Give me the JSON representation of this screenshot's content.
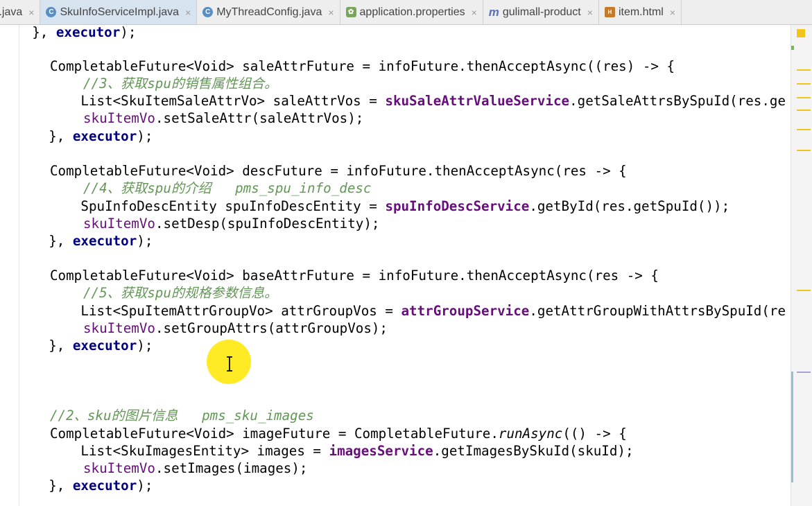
{
  "tabs": [
    {
      "label": "r.java",
      "icon": "java-file-icon",
      "active": false
    },
    {
      "label": "SkuInfoServiceImpl.java",
      "icon": "java-class-icon",
      "active": true
    },
    {
      "label": "MyThreadConfig.java",
      "icon": "java-class-icon",
      "active": false
    },
    {
      "label": "application.properties",
      "icon": "properties-file-icon",
      "active": false
    },
    {
      "label": "gulimall-product",
      "icon": "maven-module-icon",
      "active": false
    },
    {
      "label": "item.html",
      "icon": "html-file-icon",
      "active": false
    }
  ],
  "tab_icon_glyphs": {
    "java": "C",
    "props": "✿",
    "maven": "m",
    "html": "H"
  },
  "close_glyph": "×",
  "code": {
    "l1": {
      "a": "    }, ",
      "b": "executor",
      "c": ");"
    },
    "l2": "CompletableFuture<Void> saleAttrFuture = infoFuture.thenAcceptAsync((res) -> {",
    "l3": "//3、获取spu的销售属性组合。",
    "l4": {
      "a": "        List<SkuItemSaleAttrVo> saleAttrVos = ",
      "b": "skuSaleAttrValueService",
      "c": ".getSaleAttrsBySpuId(res.ge"
    },
    "l5": {
      "a": "skuItemVo",
      "b": ".setSaleAttr(saleAttrVos);"
    },
    "l6": {
      "a": "    }, ",
      "b": "executor",
      "c": ");"
    },
    "l7": "CompletableFuture<Void> descFuture = infoFuture.thenAcceptAsync(res -> {",
    "l8": "//4、获取spu的介绍   pms_spu_info_desc",
    "l9": {
      "a": "        SpuInfoDescEntity spuInfoDescEntity = ",
      "b": "spuInfoDescService",
      "c": ".getById(res.getSpuId());"
    },
    "l10": {
      "a": "skuItemVo",
      "b": ".setDesp(spuInfoDescEntity);"
    },
    "l11": {
      "a": "    }, ",
      "b": "executor",
      "c": ");"
    },
    "l12": "CompletableFuture<Void> baseAttrFuture = infoFuture.thenAcceptAsync(res -> {",
    "l13": "//5、获取spu的规格参数信息。",
    "l14": {
      "a": "        List<SpuItemAttrGroupVo> attrGroupVos = ",
      "b": "attrGroupService",
      "c": ".getAttrGroupWithAttrsBySpuId(re"
    },
    "l15": {
      "a": "skuItemVo",
      "b": ".setGroupAttrs(attrGroupVos);"
    },
    "l16": {
      "a": "    }, ",
      "b": "executor",
      "c": ");"
    },
    "l17": "//2、sku的图片信息   pms_sku_images",
    "l18": {
      "a": "CompletableFuture<Void> imageFuture = CompletableFuture.",
      "b": "runAsync",
      "c": "(() -> {"
    },
    "l19": {
      "a": "        List<SkuImagesEntity> images = ",
      "b": "imagesService",
      "c": ".getImagesBySkuId(skuId);"
    },
    "l20": {
      "a": "skuItemVo",
      "b": ".setImages(images);"
    },
    "l21": {
      "a": "    }, ",
      "b": "executor",
      "c": ");"
    }
  },
  "colors": {
    "keyword": "#000080",
    "field": "#660e7a",
    "comment": "#629755",
    "tab_active": "#d8e3f0",
    "cursor_highlight": "#ffe600"
  }
}
